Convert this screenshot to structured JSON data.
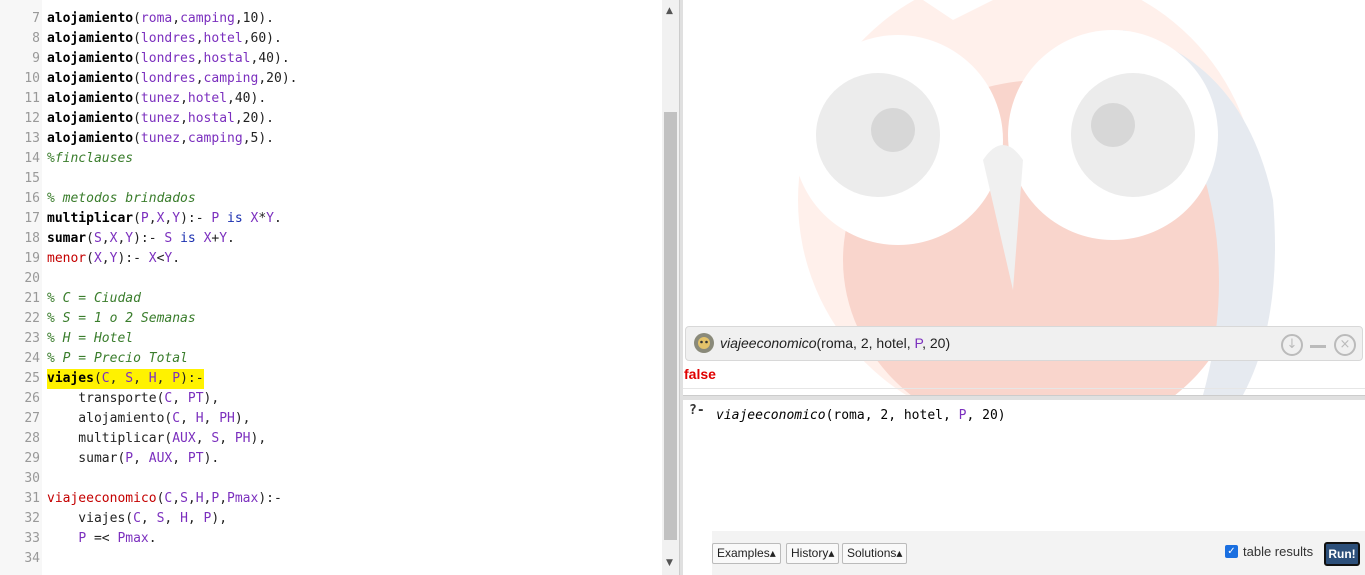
{
  "editor": {
    "lines": [
      {
        "n": "7",
        "parts": [
          [
            "atom",
            "alojamiento"
          ],
          [
            "txt",
            "("
          ],
          [
            "var",
            "roma"
          ],
          [
            "txt",
            ","
          ],
          [
            "var",
            "camping"
          ],
          [
            "txt",
            ",10)."
          ]
        ]
      },
      {
        "n": "8",
        "parts": [
          [
            "atom",
            "alojamiento"
          ],
          [
            "txt",
            "("
          ],
          [
            "var",
            "londres"
          ],
          [
            "txt",
            ","
          ],
          [
            "var",
            "hotel"
          ],
          [
            "txt",
            ",60)."
          ]
        ]
      },
      {
        "n": "9",
        "parts": [
          [
            "atom",
            "alojamiento"
          ],
          [
            "txt",
            "("
          ],
          [
            "var",
            "londres"
          ],
          [
            "txt",
            ","
          ],
          [
            "var",
            "hostal"
          ],
          [
            "txt",
            ",40)."
          ]
        ]
      },
      {
        "n": "10",
        "parts": [
          [
            "atom",
            "alojamiento"
          ],
          [
            "txt",
            "("
          ],
          [
            "var",
            "londres"
          ],
          [
            "txt",
            ","
          ],
          [
            "var",
            "camping"
          ],
          [
            "txt",
            ",20)."
          ]
        ]
      },
      {
        "n": "11",
        "parts": [
          [
            "atom",
            "alojamiento"
          ],
          [
            "txt",
            "("
          ],
          [
            "var",
            "tunez"
          ],
          [
            "txt",
            ","
          ],
          [
            "var",
            "hotel"
          ],
          [
            "txt",
            ",40)."
          ]
        ]
      },
      {
        "n": "12",
        "parts": [
          [
            "atom",
            "alojamiento"
          ],
          [
            "txt",
            "("
          ],
          [
            "var",
            "tunez"
          ],
          [
            "txt",
            ","
          ],
          [
            "var",
            "hostal"
          ],
          [
            "txt",
            ",20)."
          ]
        ]
      },
      {
        "n": "13",
        "parts": [
          [
            "atom",
            "alojamiento"
          ],
          [
            "txt",
            "("
          ],
          [
            "var",
            "tunez"
          ],
          [
            "txt",
            ","
          ],
          [
            "var",
            "camping"
          ],
          [
            "txt",
            ",5)."
          ]
        ]
      },
      {
        "n": "14",
        "parts": [
          [
            "cmt",
            "%finclauses"
          ]
        ]
      },
      {
        "n": "15",
        "parts": []
      },
      {
        "n": "16",
        "parts": [
          [
            "cmt",
            "% metodos brindados"
          ]
        ]
      },
      {
        "n": "17",
        "parts": [
          [
            "atom",
            "multiplicar"
          ],
          [
            "txt",
            "("
          ],
          [
            "var",
            "P"
          ],
          [
            "txt",
            ","
          ],
          [
            "var",
            "X"
          ],
          [
            "txt",
            ","
          ],
          [
            "var",
            "Y"
          ],
          [
            "txt",
            "):- "
          ],
          [
            "var",
            "P"
          ],
          [
            "txt",
            " "
          ],
          [
            "kw",
            "is"
          ],
          [
            "txt",
            " "
          ],
          [
            "var",
            "X"
          ],
          [
            "txt",
            "*"
          ],
          [
            "var",
            "Y"
          ],
          [
            "txt",
            "."
          ]
        ]
      },
      {
        "n": "18",
        "parts": [
          [
            "atom",
            "sumar"
          ],
          [
            "txt",
            "("
          ],
          [
            "var",
            "S"
          ],
          [
            "txt",
            ","
          ],
          [
            "var",
            "X"
          ],
          [
            "txt",
            ","
          ],
          [
            "var",
            "Y"
          ],
          [
            "txt",
            "):- "
          ],
          [
            "var",
            "S"
          ],
          [
            "txt",
            " "
          ],
          [
            "kw",
            "is"
          ],
          [
            "txt",
            " "
          ],
          [
            "var",
            "X"
          ],
          [
            "txt",
            "+"
          ],
          [
            "var",
            "Y"
          ],
          [
            "txt",
            "."
          ]
        ]
      },
      {
        "n": "19",
        "parts": [
          [
            "neg",
            "menor"
          ],
          [
            "txt",
            "("
          ],
          [
            "var",
            "X"
          ],
          [
            "txt",
            ","
          ],
          [
            "var",
            "Y"
          ],
          [
            "txt",
            "):- "
          ],
          [
            "var",
            "X"
          ],
          [
            "txt",
            "<"
          ],
          [
            "var",
            "Y"
          ],
          [
            "txt",
            "."
          ]
        ]
      },
      {
        "n": "20",
        "parts": []
      },
      {
        "n": "21",
        "parts": [
          [
            "cmt",
            "% C = Ciudad"
          ]
        ]
      },
      {
        "n": "22",
        "parts": [
          [
            "cmt",
            "% S = 1 o 2 Semanas"
          ]
        ]
      },
      {
        "n": "23",
        "parts": [
          [
            "cmt",
            "% H = Hotel"
          ]
        ]
      },
      {
        "n": "24",
        "parts": [
          [
            "cmt",
            "% P = Precio Total"
          ]
        ]
      },
      {
        "n": "25",
        "hl": true,
        "parts": [
          [
            "atom",
            "viajes"
          ],
          [
            "txt",
            "("
          ],
          [
            "var",
            "C"
          ],
          [
            "txt",
            ", "
          ],
          [
            "var",
            "S"
          ],
          [
            "txt",
            ", "
          ],
          [
            "var",
            "H"
          ],
          [
            "txt",
            ", "
          ],
          [
            "var",
            "P"
          ],
          [
            "txt",
            "):-"
          ]
        ]
      },
      {
        "n": "26",
        "parts": [
          [
            "txt",
            "    transporte("
          ],
          [
            "var",
            "C"
          ],
          [
            "txt",
            ", "
          ],
          [
            "var",
            "PT"
          ],
          [
            "txt",
            "),"
          ]
        ]
      },
      {
        "n": "27",
        "parts": [
          [
            "txt",
            "    alojamiento("
          ],
          [
            "var",
            "C"
          ],
          [
            "txt",
            ", "
          ],
          [
            "var",
            "H"
          ],
          [
            "txt",
            ", "
          ],
          [
            "var",
            "PH"
          ],
          [
            "txt",
            "),"
          ]
        ]
      },
      {
        "n": "28",
        "parts": [
          [
            "txt",
            "    multiplicar("
          ],
          [
            "var",
            "AUX"
          ],
          [
            "txt",
            ", "
          ],
          [
            "var",
            "S"
          ],
          [
            "txt",
            ", "
          ],
          [
            "var",
            "PH"
          ],
          [
            "txt",
            "),"
          ]
        ]
      },
      {
        "n": "29",
        "parts": [
          [
            "txt",
            "    sumar("
          ],
          [
            "var",
            "P"
          ],
          [
            "txt",
            ", "
          ],
          [
            "var",
            "AUX"
          ],
          [
            "txt",
            ", "
          ],
          [
            "var",
            "PT"
          ],
          [
            "txt",
            ")."
          ]
        ]
      },
      {
        "n": "30",
        "parts": []
      },
      {
        "n": "31",
        "parts": [
          [
            "neg",
            "viajeeconomico"
          ],
          [
            "txt",
            "("
          ],
          [
            "var",
            "C"
          ],
          [
            "txt",
            ","
          ],
          [
            "var",
            "S"
          ],
          [
            "txt",
            ","
          ],
          [
            "var",
            "H"
          ],
          [
            "txt",
            ","
          ],
          [
            "var",
            "P"
          ],
          [
            "txt",
            ","
          ],
          [
            "var",
            "Pmax"
          ],
          [
            "txt",
            "):-"
          ]
        ]
      },
      {
        "n": "32",
        "parts": [
          [
            "txt",
            "    viajes("
          ],
          [
            "var",
            "C"
          ],
          [
            "txt",
            ", "
          ],
          [
            "var",
            "S"
          ],
          [
            "txt",
            ", "
          ],
          [
            "var",
            "H"
          ],
          [
            "txt",
            ", "
          ],
          [
            "var",
            "P"
          ],
          [
            "txt",
            "),"
          ]
        ]
      },
      {
        "n": "33",
        "parts": [
          [
            "txt",
            "    "
          ],
          [
            "var",
            "P"
          ],
          [
            "txt",
            " =< "
          ],
          [
            "var",
            "Pmax"
          ],
          [
            "txt",
            "."
          ]
        ]
      },
      {
        "n": "34",
        "parts": []
      }
    ]
  },
  "runner": {
    "query_fn": "viajeeconomico",
    "query_args": "(roma, 2, hotel, ",
    "query_var": "P",
    "query_tail": ", 20)",
    "answer": "false"
  },
  "query_editor": {
    "prompt": "?-",
    "fn": "viajeeconomico",
    "open": "(roma, 2, hotel, ",
    "var": "P",
    "tail": ", 20)"
  },
  "toolbar": {
    "examples": "Examples▴",
    "history": "History▴",
    "solutions": "Solutions▴",
    "table_results_label": "table results",
    "table_results_checked": true,
    "run": "Run!"
  },
  "colors": {
    "var": "#7b2fbe",
    "highlight": "#fff200",
    "error": "#e00000",
    "run_button": "#2c4f7a"
  }
}
